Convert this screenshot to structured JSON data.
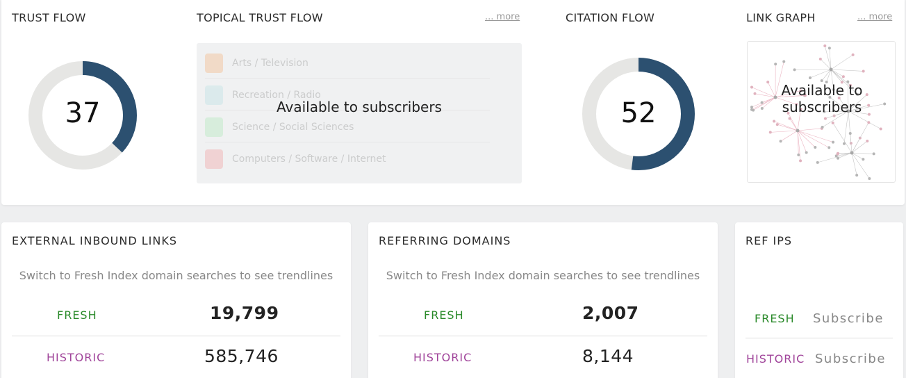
{
  "trust_flow": {
    "title": "TRUST FLOW",
    "value": "37",
    "fraction": 0.37,
    "color": "#2c5070",
    "track_color": "#e6e6e4"
  },
  "topical_trust_flow": {
    "title": "TOPICAL TRUST FLOW",
    "more_label": "... more",
    "overlay": "Available to subscribers",
    "topics": [
      {
        "label": "Arts / Television",
        "color": "#f5b27a"
      },
      {
        "label": "Recreation / Radio",
        "color": "#b7dfe2"
      },
      {
        "label": "Science / Social Sciences",
        "color": "#a9e6b6"
      },
      {
        "label": "Computers / Software / Internet",
        "color": "#f29a9a"
      }
    ]
  },
  "citation_flow": {
    "title": "CITATION FLOW",
    "value": "52",
    "fraction": 0.52,
    "color": "#2c5070",
    "track_color": "#e6e6e4"
  },
  "link_graph": {
    "title": "LINK GRAPH",
    "more_label": "... more",
    "overlay_line1": "Available to",
    "overlay_line2": "subscribers"
  },
  "external_inbound_links": {
    "title": "EXTERNAL INBOUND LINKS",
    "hint": "Switch to Fresh Index domain searches to see trendlines",
    "fresh_label": "FRESH",
    "fresh_value": "19,799",
    "historic_label": "HISTORIC",
    "historic_value": "585,746"
  },
  "referring_domains": {
    "title": "REFERRING DOMAINS",
    "hint": "Switch to Fresh Index domain searches to see trendlines",
    "fresh_label": "FRESH",
    "fresh_value": "2,007",
    "historic_label": "HISTORIC",
    "historic_value": "8,144"
  },
  "ref_ips": {
    "title": "REF IPS",
    "fresh_label": "FRESH",
    "fresh_action": "Subscribe",
    "historic_label": "HISTORIC",
    "historic_action": "Subscribe"
  },
  "colors": {
    "fresh": "#2a8a2a",
    "historic": "#a0449a"
  }
}
